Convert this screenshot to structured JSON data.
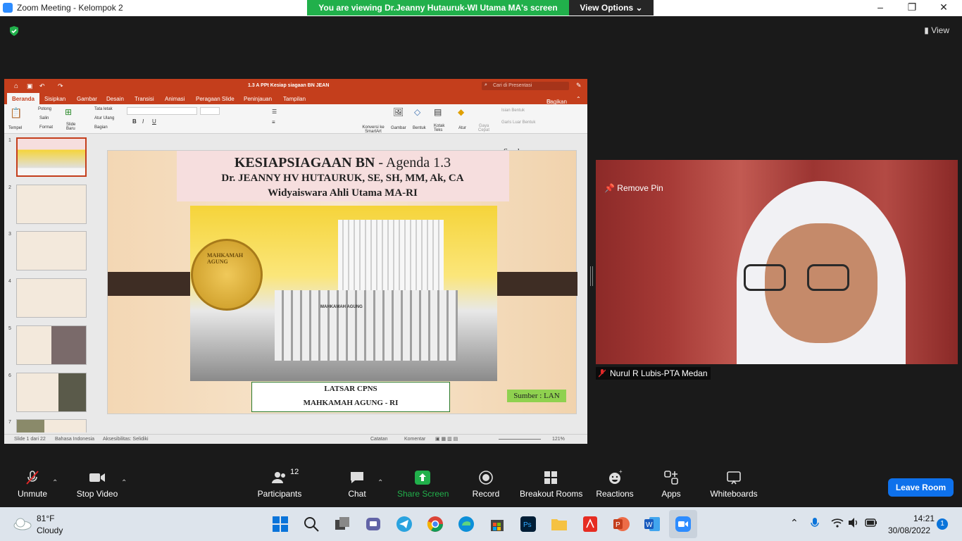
{
  "window": {
    "title": "Zoom Meeting - Kelompok 2",
    "viewing_banner": "You are viewing Dr.Jeanny Hutauruk-WI Utama MA's screen",
    "view_options": "View Options",
    "view_label": "View"
  },
  "ppt": {
    "doc_title": "1.3 A PPt Kesiap siagaan BN JEAN",
    "search_placeholder": "Cari di Presentasi",
    "share": "Bagikan",
    "tabs": [
      "Beranda",
      "Sisipkan",
      "Gambar",
      "Desain",
      "Transisi",
      "Animasi",
      "Peragaan Slide",
      "Peninjauan",
      "Tampilan"
    ],
    "ribbon": {
      "tempel": "Tempel",
      "potong": "Potong",
      "salin": "Salin",
      "format": "Format",
      "slide_baru": "Slide Baru",
      "tata_letak": "Tata letak",
      "atur_ulang": "Atur Ulang",
      "bagian": "Bagian",
      "konversi": "Konversi ke SmartArt",
      "gambar": "Gambar",
      "bentuk": "Bentuk",
      "kotak_teks": "Kotak Teks",
      "atur": "Atur",
      "gaya_cepat": "Gaya Cepat",
      "isian_bentuk": "Isian Bentuk",
      "garis_luar": "Garis Luar Bentuk"
    },
    "sumber_top": "Sumber",
    "thumb_numbers": [
      "1",
      "2",
      "3",
      "4",
      "5",
      "6",
      "7"
    ],
    "status": {
      "slide": "Slide 1 dari 22",
      "lang": "Bahasa Indonesia",
      "access": "Aksesibilitas: Selidiki",
      "notes": "Catatan",
      "comments": "Komentar",
      "zoom": "121%"
    },
    "slide": {
      "title_bold": "KESIAPSIAGAAN BN",
      "title_rest": " - Agenda 1.3",
      "author": "Dr.  JEANNY HV HUTAURUK, SE, SH, MM, Ak, CA",
      "role": "Widyaiswara Ahli Utama MA-RI",
      "latsar": "LATSAR CPNS",
      "institution": "MAHKAMAH AGUNG - RI",
      "sumber": "Sumber : LAN",
      "seal_text": "MAHKAMAH AGUNG",
      "building_text": "MAHKAMAH AGUNG"
    }
  },
  "video": {
    "remove_pin": "Remove Pin",
    "participant_name": "Nurul R Lubis-PTA Medan"
  },
  "controls": {
    "unmute": "Unmute",
    "stop_video": "Stop Video",
    "participants": "Participants",
    "participant_count": "12",
    "chat": "Chat",
    "share_screen": "Share Screen",
    "record": "Record",
    "breakout_rooms": "Breakout Rooms",
    "reactions": "Reactions",
    "apps": "Apps",
    "whiteboards": "Whiteboards",
    "leave": "Leave Room"
  },
  "taskbar": {
    "temp": "81°F",
    "weather": "Cloudy",
    "time": "14:21",
    "date": "30/08/2022",
    "notif_count": "1"
  },
  "colors": {
    "zoom_green": "#21b04b",
    "ppt_red": "#c43e1c",
    "leave_blue": "#0e71eb",
    "share_green": "#21b04b"
  }
}
